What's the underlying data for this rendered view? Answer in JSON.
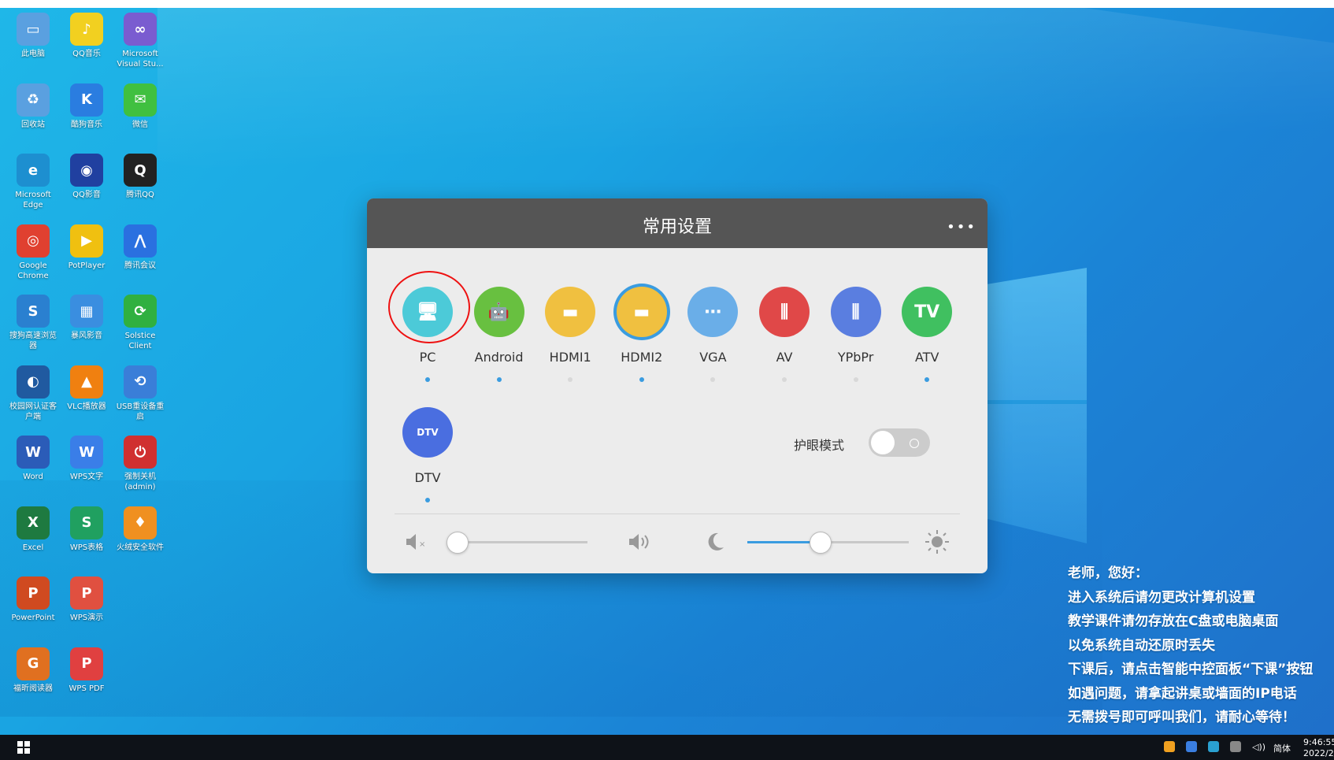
{
  "desktop_icons": [
    {
      "id": "thispc",
      "label": "此电脑",
      "col": 0,
      "row": 0,
      "color": "#5aa0e0",
      "glyph": "▭"
    },
    {
      "id": "qqmusic",
      "label": "QQ音乐",
      "col": 1,
      "row": 0,
      "color": "#f2d020",
      "glyph": "♪"
    },
    {
      "id": "vs",
      "label": "Microsoft Visual Stu...",
      "col": 2,
      "row": 0,
      "color": "#7a5cd0",
      "glyph": "∞"
    },
    {
      "id": "recycle",
      "label": "回收站",
      "col": 0,
      "row": 1,
      "color": "#5aa0e0",
      "glyph": "♻"
    },
    {
      "id": "kugou",
      "label": "酷狗音乐",
      "col": 1,
      "row": 1,
      "color": "#2a7de0",
      "glyph": "K"
    },
    {
      "id": "wechat",
      "label": "微信",
      "col": 2,
      "row": 1,
      "color": "#40c040",
      "glyph": "✉"
    },
    {
      "id": "edge",
      "label": "Microsoft Edge",
      "col": 0,
      "row": 2,
      "color": "#1d8fd0",
      "glyph": "e"
    },
    {
      "id": "qqvideo",
      "label": "QQ影音",
      "col": 1,
      "row": 2,
      "color": "#2040a0",
      "glyph": "◉"
    },
    {
      "id": "qq",
      "label": "腾讯QQ",
      "col": 2,
      "row": 2,
      "color": "#222222",
      "glyph": "Q"
    },
    {
      "id": "chrome",
      "label": "Google Chrome",
      "col": 0,
      "row": 3,
      "color": "#e04030",
      "glyph": "◎"
    },
    {
      "id": "potplayer",
      "label": "PotPlayer",
      "col": 1,
      "row": 3,
      "color": "#f0c010",
      "glyph": "▶"
    },
    {
      "id": "tencentmeeting",
      "label": "腾讯会议",
      "col": 2,
      "row": 3,
      "color": "#2a70e0",
      "glyph": "⋀"
    },
    {
      "id": "sogou",
      "label": "搜狗高速浏览器",
      "col": 0,
      "row": 4,
      "color": "#2a80d0",
      "glyph": "S"
    },
    {
      "id": "baofeng",
      "label": "暴风影音",
      "col": 1,
      "row": 4,
      "color": "#3a8ee0",
      "glyph": "▦"
    },
    {
      "id": "solstice",
      "label": "Solstice Client",
      "col": 2,
      "row": 4,
      "color": "#30b040",
      "glyph": "⟳"
    },
    {
      "id": "campusnet",
      "label": "校园网认证客户端",
      "col": 0,
      "row": 5,
      "color": "#205aa0",
      "glyph": "◐"
    },
    {
      "id": "vlc",
      "label": "VLC播放器",
      "col": 1,
      "row": 5,
      "color": "#f08010",
      "glyph": "▲"
    },
    {
      "id": "usbreset",
      "label": "USB重设备重启",
      "col": 2,
      "row": 5,
      "color": "#3a7ed8",
      "glyph": "⟲"
    },
    {
      "id": "word",
      "label": "Word",
      "col": 0,
      "row": 6,
      "color": "#2b5cb8",
      "glyph": "W"
    },
    {
      "id": "wpswriter",
      "label": "WPS文字",
      "col": 1,
      "row": 6,
      "color": "#3a7ee8",
      "glyph": "W"
    },
    {
      "id": "forceshutdown",
      "label": "强制关机 (admin)",
      "col": 2,
      "row": 6,
      "color": "#d03030",
      "glyph": "⏻"
    },
    {
      "id": "excel",
      "label": "Excel",
      "col": 0,
      "row": 7,
      "color": "#1e7a40",
      "glyph": "X"
    },
    {
      "id": "wpssheet",
      "label": "WPS表格",
      "col": 1,
      "row": 7,
      "color": "#20a060",
      "glyph": "S"
    },
    {
      "id": "huorong",
      "label": "火绒安全软件",
      "col": 2,
      "row": 7,
      "color": "#f09020",
      "glyph": "♦"
    },
    {
      "id": "powerpoint",
      "label": "PowerPoint",
      "col": 0,
      "row": 8,
      "color": "#d04a20",
      "glyph": "P"
    },
    {
      "id": "wpspresent",
      "label": "WPS演示",
      "col": 1,
      "row": 8,
      "color": "#e05040",
      "glyph": "P"
    },
    {
      "id": "foxit",
      "label": "福昕阅读器",
      "col": 0,
      "row": 9,
      "color": "#e07020",
      "glyph": "G"
    },
    {
      "id": "wpspdf",
      "label": "WPS PDF",
      "col": 1,
      "row": 9,
      "color": "#e04040",
      "glyph": "P"
    }
  ],
  "dialog": {
    "title": "常用设置",
    "more": "•••",
    "sources": [
      {
        "id": "pc",
        "label": "PC",
        "color": "#4ccad8",
        "glyph": "🖥",
        "active": true
      },
      {
        "id": "android",
        "label": "Android",
        "color": "#68c040",
        "glyph": "🤖",
        "active": true
      },
      {
        "id": "hdmi1",
        "label": "HDMI1",
        "color": "#f0c040",
        "glyph": "▬",
        "active": false
      },
      {
        "id": "hdmi2",
        "label": "HDMI2",
        "color": "#f0c040",
        "glyph": "▬",
        "active": true
      },
      {
        "id": "vga",
        "label": "VGA",
        "color": "#6aaee8",
        "glyph": "⋯",
        "active": false
      },
      {
        "id": "av",
        "label": "AV",
        "color": "#e04848",
        "glyph": "⫼",
        "active": false
      },
      {
        "id": "ypbpr",
        "label": "YPbPr",
        "color": "#5a7ee0",
        "glyph": "⫼",
        "active": false
      },
      {
        "id": "atv",
        "label": "ATV",
        "color": "#40c060",
        "glyph": "TV",
        "active": true
      },
      {
        "id": "dtv",
        "label": "DTV",
        "color": "#4a6ee0",
        "glyph": "DTV",
        "active": true
      }
    ],
    "eye_mode_label": "护眼模式",
    "eye_mode_on": false,
    "volume_level": 0.05,
    "brightness_level": 0.45
  },
  "notice": [
    "老师，您好：",
    "进入系统后请勿更改计算机设置",
    "教学课件请勿存放在C盘或电脑桌面",
    "以免系统自动还原时丢失",
    "下课后，请点击智能中控面板“下课”按钮",
    "如遇问题，请拿起讲桌或墙面的IP电话",
    "无需拨号即可呼叫我们，请耐心等待！"
  ],
  "taskbar": {
    "ime": "简体",
    "time": "9:46:55",
    "date": "2022/2/"
  }
}
